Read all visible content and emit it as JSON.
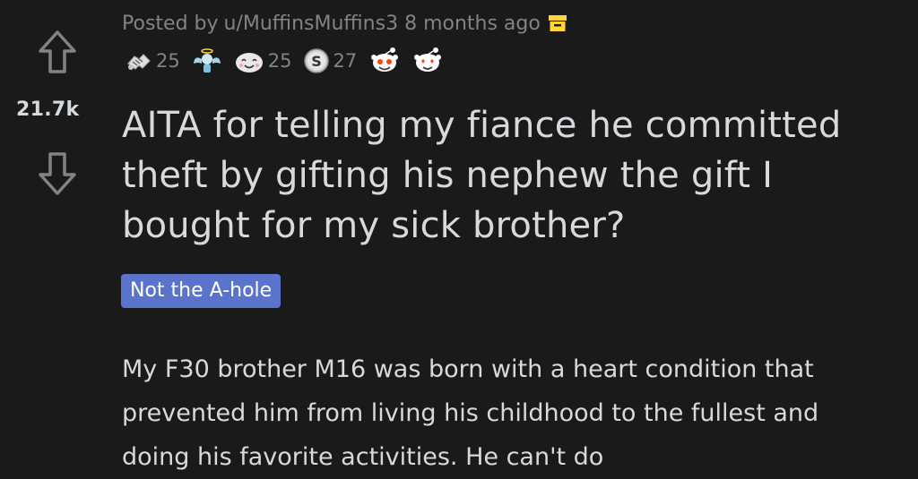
{
  "post": {
    "meta": {
      "posted_by": "Posted by",
      "username": "u/MuffinsMuffins3",
      "time": "8 months ago"
    },
    "awards": [
      {
        "icon": "handshake-award-icon",
        "count": "25"
      },
      {
        "icon": "angel-wings-award-icon",
        "count": ""
      },
      {
        "icon": "wholesome-face-award-icon",
        "count": "25"
      },
      {
        "icon": "silver-coin-award-icon",
        "count": "27"
      },
      {
        "icon": "snoo-excited-award-icon",
        "count": ""
      },
      {
        "icon": "snoo-hearts-award-icon",
        "count": ""
      }
    ],
    "score": "21.7k",
    "title": "AITA for telling my fiance he committed theft by gifting his nephew the gift I bought for my sick brother?",
    "flair": "Not the A-hole",
    "body": "My F30 brother M16 was born with a heart condition that prevented him from living his childhood to the fullest and doing his favorite activities. He can't do"
  },
  "colors": {
    "background": "#1a1a1b",
    "text_primary": "#d7dadc",
    "text_secondary": "#818384",
    "flair_bg": "#5a74cc",
    "archive_icon": "#ffd635"
  }
}
